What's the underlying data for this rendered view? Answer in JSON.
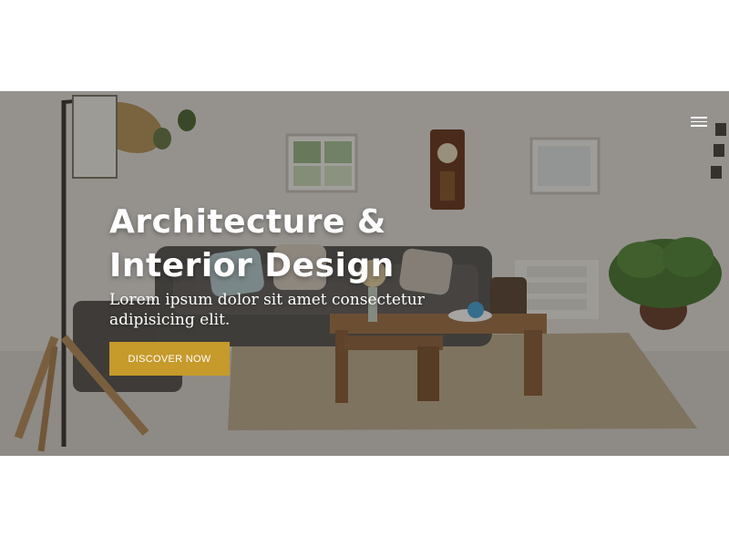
{
  "hero": {
    "title": "Architecture &\nInterior Design",
    "subtitle": "Lorem ipsum dolor sit amet consectetur adipisicing elit.",
    "cta_label": "DISCOVER NOW"
  },
  "icons": {
    "menu": "hamburger-menu-icon",
    "scroll_top": "arrow-up-icon"
  },
  "colors": {
    "accent": "#c69a2b",
    "scroll_top_bg": "#e8b33a",
    "overlay": "rgba(20,18,16,0.38)"
  }
}
